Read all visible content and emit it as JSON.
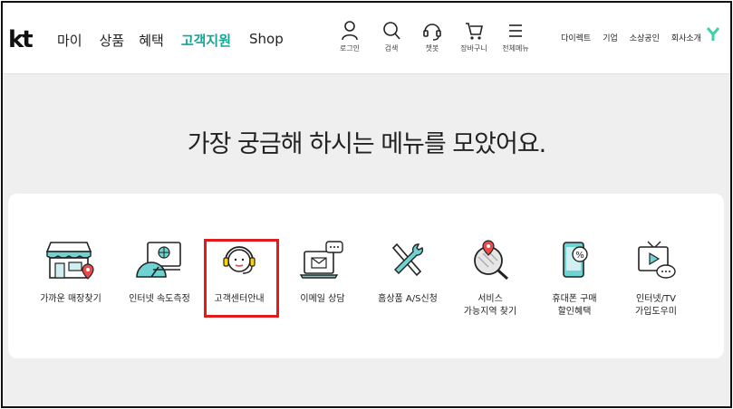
{
  "logo": "kt",
  "nav": [
    "마이",
    "상품",
    "혜택",
    "고객지원",
    "Shop"
  ],
  "utils": [
    {
      "label": "로그인",
      "icon": "user-icon"
    },
    {
      "label": "검색",
      "icon": "search-icon"
    },
    {
      "label": "챗봇",
      "icon": "chatbot-headset-icon"
    },
    {
      "label": "장바구니",
      "icon": "cart-icon"
    },
    {
      "label": "전체메뉴",
      "icon": "menu-icon"
    }
  ],
  "links": [
    "다이렉트",
    "기업",
    "소상공인",
    "회사소개"
  ],
  "heading": "가장 궁금해 하시는 메뉴를 모았어요.",
  "menu": [
    {
      "label": "가까운 매장찾기",
      "icon": "store-location-icon"
    },
    {
      "label": "인터넷 속도측정",
      "icon": "speed-test-icon"
    },
    {
      "label": "고객센터안내",
      "icon": "headset-agent-icon"
    },
    {
      "label": "이메일 상담",
      "icon": "email-laptop-icon"
    },
    {
      "label": "홈상품 A/S신청",
      "icon": "tools-icon"
    },
    {
      "label": "서비스\n가능지역 찾기",
      "icon": "map-search-icon"
    },
    {
      "label": "휴대폰 구매\n할인혜택",
      "icon": "phone-discount-icon"
    },
    {
      "label": "인터넷/TV\n가입도우미",
      "icon": "tv-chat-icon"
    }
  ],
  "colors": {
    "accent": "#14a595",
    "highlight": "#e11b1b",
    "yellow": "#ffd400"
  }
}
